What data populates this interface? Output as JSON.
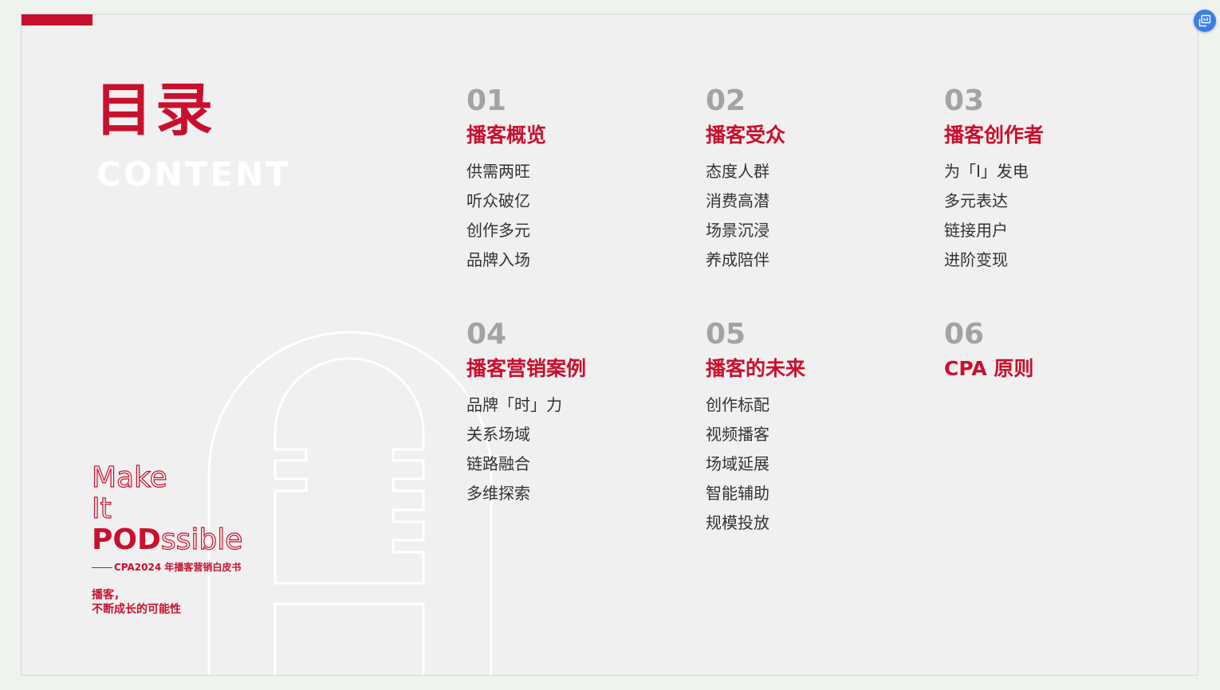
{
  "title_cn": "目录",
  "title_en": "CONTENT",
  "sections": [
    {
      "num": "01",
      "title": "播客概览",
      "items": [
        "供需两旺",
        "听众破亿",
        "创作多元",
        "品牌入场"
      ]
    },
    {
      "num": "02",
      "title": "播客受众",
      "items": [
        "态度人群",
        "消费高潜",
        "场景沉浸",
        "养成陪伴"
      ]
    },
    {
      "num": "03",
      "title": "播客创作者",
      "items": [
        "为「I」发电",
        "多元表达",
        "链接用户",
        "进阶变现"
      ]
    },
    {
      "num": "04",
      "title": "播客营销案例",
      "items": [
        "品牌「时」力",
        "关系场域",
        "链路融合",
        "多维探索"
      ]
    },
    {
      "num": "05",
      "title": "播客的未来",
      "items": [
        "创作标配",
        "视频播客",
        "场域延展",
        "智能辅助",
        "规模投放"
      ]
    },
    {
      "num": "06",
      "title": "CPA 原则",
      "items": []
    }
  ],
  "slogan": {
    "line1": "Make",
    "line2": "It",
    "line3_solid": "POD",
    "line3_outline": "ssible",
    "subtitle": "CPA2024 年播客营销白皮书",
    "tagline1": "播客，",
    "tagline2": "不断成长的可能性"
  },
  "colors": {
    "accent": "#c8102e",
    "number_gray": "#a3a3a3",
    "background": "#f0f0f0",
    "floating_button": "#3a7ee8"
  },
  "icons": {
    "floating_button": "screen-translate-icon",
    "illustration": "microphone-outline-icon"
  }
}
